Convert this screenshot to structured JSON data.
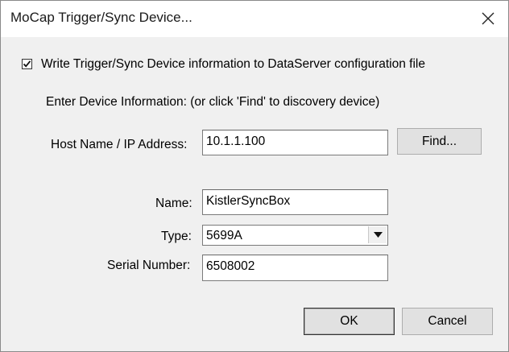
{
  "window": {
    "title": "MoCap Trigger/Sync Device...",
    "close_icon": "close-icon"
  },
  "options": {
    "write_config_label": "Write Trigger/Sync Device information to DataServer configuration file",
    "write_config_checked": true
  },
  "instructions": "Enter Device Information: (or click 'Find' to discovery device)",
  "host": {
    "label": "Host Name / IP Address:",
    "value": "10.1.1.100",
    "find_label": "Find..."
  },
  "device": {
    "name_label": "Name:",
    "name_value": "KistlerSyncBox",
    "type_label": "Type:",
    "type_value": "5699A",
    "serial_label": "Serial Number:",
    "serial_value": "6508002"
  },
  "footer": {
    "ok_label": "OK",
    "cancel_label": "Cancel"
  }
}
